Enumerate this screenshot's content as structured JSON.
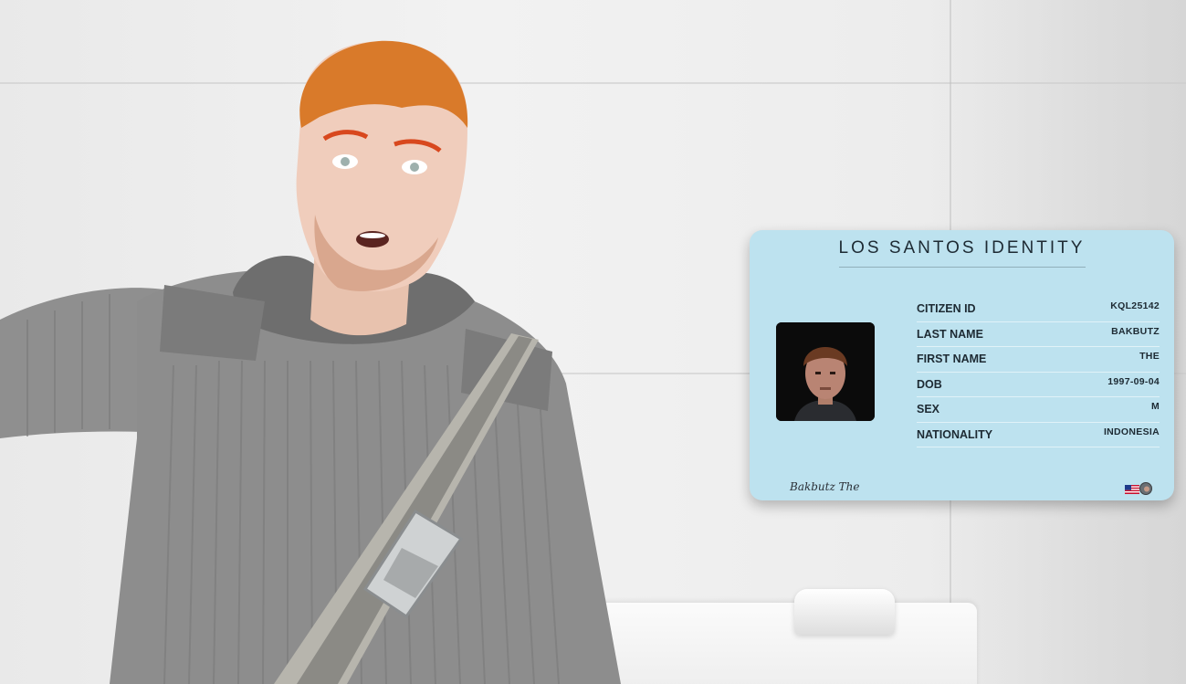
{
  "id_card": {
    "title": "LOS SANTOS  IDENTITY",
    "fields": [
      {
        "label": "CITIZEN ID",
        "value": "KQL25142"
      },
      {
        "label": "LAST NAME",
        "value": "BAKBUTZ"
      },
      {
        "label": "FIRST NAME",
        "value": "THE"
      },
      {
        "label": "DOB",
        "value": "1997-09-04"
      },
      {
        "label": "SEX",
        "value": "M"
      },
      {
        "label": "NATIONALITY",
        "value": "INDONESIA"
      }
    ],
    "signature": "Bakbutz The",
    "card_color": "#bde2ef",
    "flag_icon": "us-flag-icon"
  }
}
